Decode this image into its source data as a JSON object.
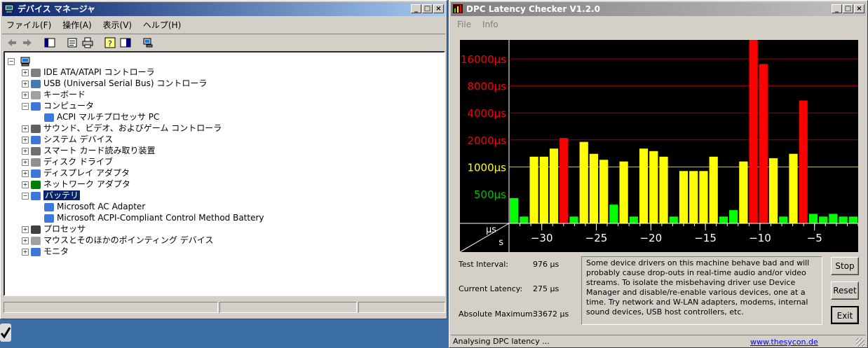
{
  "device_manager": {
    "title": "デバイス マネージャ",
    "menu": [
      "ファイル(F)",
      "操作(A)",
      "表示(V)",
      "ヘルプ(H)"
    ],
    "tree": [
      {
        "label": "IDE ATA/ATAPI コントローラ",
        "level": 1,
        "expander": "+"
      },
      {
        "label": "USB (Universal Serial Bus) コントローラ",
        "level": 1,
        "expander": "+"
      },
      {
        "label": "キーボード",
        "level": 1,
        "expander": "+"
      },
      {
        "label": "コンピュータ",
        "level": 1,
        "expander": "-"
      },
      {
        "label": "ACPI マルチプロセッサ PC",
        "level": 2,
        "expander": ""
      },
      {
        "label": "サウンド、ビデオ、およびゲーム コントローラ",
        "level": 1,
        "expander": "+"
      },
      {
        "label": "システム デバイス",
        "level": 1,
        "expander": "+"
      },
      {
        "label": "スマート カード読み取り装置",
        "level": 1,
        "expander": "+"
      },
      {
        "label": "ディスク ドライブ",
        "level": 1,
        "expander": "+"
      },
      {
        "label": "ディスプレイ アダプタ",
        "level": 1,
        "expander": "+"
      },
      {
        "label": "ネットワーク アダプタ",
        "level": 1,
        "expander": "+"
      },
      {
        "label": "バッテリ",
        "level": 1,
        "expander": "-",
        "selected": true
      },
      {
        "label": "Microsoft AC Adapter",
        "level": 2,
        "expander": ""
      },
      {
        "label": "Microsoft ACPI-Compliant Control Method Battery",
        "level": 2,
        "expander": ""
      },
      {
        "label": "プロセッサ",
        "level": 1,
        "expander": "+"
      },
      {
        "label": "マウスとそのほかのポインティング デバイス",
        "level": 1,
        "expander": "+"
      },
      {
        "label": "モニタ",
        "level": 1,
        "expander": "+"
      }
    ]
  },
  "dpc": {
    "title": "DPC Latency Checker V1.2.0",
    "menu": [
      "File",
      "Info"
    ],
    "labels": {
      "test_interval": "Test Interval:",
      "current_latency": "Current Latency:",
      "absolute_maximum": "Absolute Maximum:"
    },
    "values": {
      "test_interval": "976 µs",
      "current_latency": "275 µs",
      "absolute_maximum": "33672 µs"
    },
    "message": "Some device drivers on this machine behave bad and will probably cause drop-outs in real-time audio and/or video streams. To isolate the misbehaving driver use Device Manager and disable/re-enable various devices, one at a time. Try network and W-LAN adapters, modems, internal sound devices, USB host controllers, etc.",
    "buttons": {
      "stop": "Stop",
      "reset": "Reset",
      "exit": "Exit"
    },
    "status": "Analysing DPC latency ...",
    "link": "www.thesycon.de"
  },
  "chart_data": {
    "type": "bar",
    "y_scale": "log",
    "ylabel": "µs",
    "xlabel": "s",
    "y_ticks": [
      {
        "value": 500,
        "label": "500µs",
        "color": "#00c000"
      },
      {
        "value": 1000,
        "label": "1000µs",
        "color": "#ffff00"
      },
      {
        "value": 2000,
        "label": "2000µs",
        "color": "#ff0000"
      },
      {
        "value": 4000,
        "label": "4000µs",
        "color": "#ff0000"
      },
      {
        "value": 8000,
        "label": "8000µs",
        "color": "#ff0000"
      },
      {
        "value": 16000,
        "label": "16000µs",
        "color": "#ff0000"
      }
    ],
    "x_ticks": [
      {
        "value": -30,
        "label": "−30"
      },
      {
        "value": -25,
        "label": "−25"
      },
      {
        "value": -20,
        "label": "−20"
      },
      {
        "value": -15,
        "label": "−15"
      },
      {
        "value": -10,
        "label": "−10"
      },
      {
        "value": -5,
        "label": "−5"
      }
    ],
    "x_start": -33,
    "x_end": -1,
    "bar_width_s": 1,
    "values": [
      450,
      280,
      1300,
      1300,
      1600,
      2100,
      280,
      1900,
      1400,
      1200,
      380,
      1150,
      280,
      1600,
      1500,
      1300,
      280,
      900,
      900,
      900,
      1300,
      280,
      330,
      1150,
      30000,
      14000,
      1250,
      280,
      1400,
      5500,
      300,
      280,
      300,
      280,
      280
    ],
    "colors": {
      "green": "#00ff00",
      "yellow": "#ffff00",
      "red": "#ff0000"
    }
  }
}
